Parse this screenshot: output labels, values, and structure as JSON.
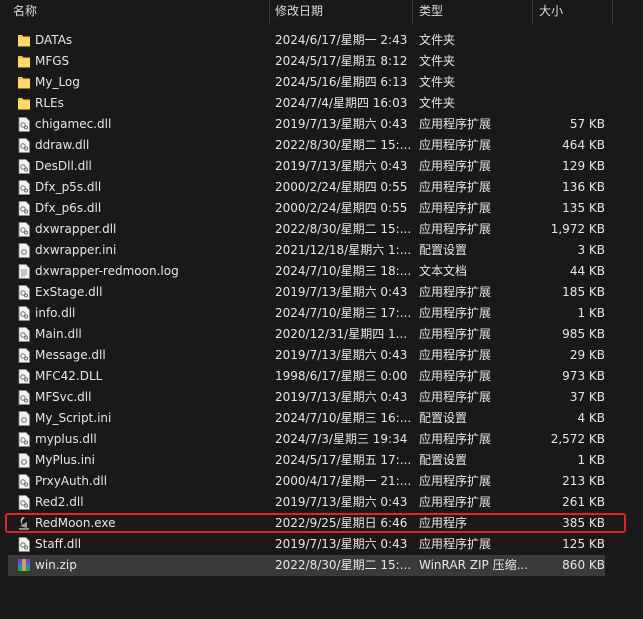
{
  "columns": {
    "name": "名称",
    "date": "修改日期",
    "type": "类型",
    "size": "大小"
  },
  "files": [
    {
      "name": "DATAs",
      "date": "2024/6/17/星期一 2:43",
      "type": "文件夹",
      "size": "",
      "icon": "folder-icon"
    },
    {
      "name": "MFGS",
      "date": "2024/5/17/星期五 8:12",
      "type": "文件夹",
      "size": "",
      "icon": "folder-icon"
    },
    {
      "name": "My_Log",
      "date": "2024/5/16/星期四 6:13",
      "type": "文件夹",
      "size": "",
      "icon": "folder-icon"
    },
    {
      "name": "RLEs",
      "date": "2024/7/4/星期四 16:03",
      "type": "文件夹",
      "size": "",
      "icon": "folder-icon"
    },
    {
      "name": "chigamec.dll",
      "date": "2019/7/13/星期六 0:43",
      "type": "应用程序扩展",
      "size": "57 KB",
      "icon": "dll-file-icon"
    },
    {
      "name": "ddraw.dll",
      "date": "2022/8/30/星期二 15:...",
      "type": "应用程序扩展",
      "size": "464 KB",
      "icon": "dll-file-icon"
    },
    {
      "name": "DesDll.dll",
      "date": "2019/7/13/星期六 0:43",
      "type": "应用程序扩展",
      "size": "129 KB",
      "icon": "dll-file-icon"
    },
    {
      "name": "Dfx_p5s.dll",
      "date": "2000/2/24/星期四 0:55",
      "type": "应用程序扩展",
      "size": "136 KB",
      "icon": "dll-file-icon"
    },
    {
      "name": "Dfx_p6s.dll",
      "date": "2000/2/24/星期四 0:55",
      "type": "应用程序扩展",
      "size": "135 KB",
      "icon": "dll-file-icon"
    },
    {
      "name": "dxwrapper.dll",
      "date": "2022/8/30/星期二 15:...",
      "type": "应用程序扩展",
      "size": "1,972 KB",
      "icon": "dll-file-icon"
    },
    {
      "name": "dxwrapper.ini",
      "date": "2021/12/18/星期六 1:...",
      "type": "配置设置",
      "size": "3 KB",
      "icon": "ini-file-icon"
    },
    {
      "name": "dxwrapper-redmoon.log",
      "date": "2024/7/10/星期三 18:...",
      "type": "文本文档",
      "size": "44 KB",
      "icon": "text-file-icon"
    },
    {
      "name": "ExStage.dll",
      "date": "2019/7/13/星期六 0:43",
      "type": "应用程序扩展",
      "size": "185 KB",
      "icon": "dll-file-icon"
    },
    {
      "name": "info.dll",
      "date": "2024/7/10/星期三 17:...",
      "type": "应用程序扩展",
      "size": "1 KB",
      "icon": "dll-file-icon"
    },
    {
      "name": "Main.dll",
      "date": "2020/12/31/星期四 1...",
      "type": "应用程序扩展",
      "size": "985 KB",
      "icon": "dll-file-icon"
    },
    {
      "name": "Message.dll",
      "date": "2019/7/13/星期六 0:43",
      "type": "应用程序扩展",
      "size": "29 KB",
      "icon": "dll-file-icon"
    },
    {
      "name": "MFC42.DLL",
      "date": "1998/6/17/星期三 0:00",
      "type": "应用程序扩展",
      "size": "973 KB",
      "icon": "dll-file-icon"
    },
    {
      "name": "MFSvc.dll",
      "date": "2019/7/13/星期六 0:43",
      "type": "应用程序扩展",
      "size": "37 KB",
      "icon": "dll-file-icon"
    },
    {
      "name": "My_Script.ini",
      "date": "2024/7/10/星期三 16:...",
      "type": "配置设置",
      "size": "4 KB",
      "icon": "ini-file-icon"
    },
    {
      "name": "myplus.dll",
      "date": "2024/7/3/星期三 19:34",
      "type": "应用程序扩展",
      "size": "2,572 KB",
      "icon": "dll-file-icon"
    },
    {
      "name": "MyPlus.ini",
      "date": "2024/5/17/星期五 17:...",
      "type": "配置设置",
      "size": "1 KB",
      "icon": "ini-file-icon"
    },
    {
      "name": "PrxyAuth.dll",
      "date": "2000/4/17/星期一 21:...",
      "type": "应用程序扩展",
      "size": "213 KB",
      "icon": "dll-file-icon"
    },
    {
      "name": "Red2.dll",
      "date": "2019/7/13/星期六 0:43",
      "type": "应用程序扩展",
      "size": "261 KB",
      "icon": "dll-file-icon"
    },
    {
      "name": "RedMoon.exe",
      "date": "2022/9/25/星期日 6:46",
      "type": "应用程序",
      "size": "385 KB",
      "icon": "exe-app-icon"
    },
    {
      "name": "Staff.dll",
      "date": "2019/7/13/星期六 0:43",
      "type": "应用程序扩展",
      "size": "125 KB",
      "icon": "dll-file-icon"
    },
    {
      "name": "win.zip",
      "date": "2022/8/30/星期二 15:...",
      "type": "WinRAR ZIP 压缩...",
      "size": "860 KB",
      "icon": "winrar-archive-icon"
    }
  ],
  "highlight": {
    "outlined": "RedMoon.exe",
    "selected": "win.zip",
    "outline_color": "#e02424"
  }
}
